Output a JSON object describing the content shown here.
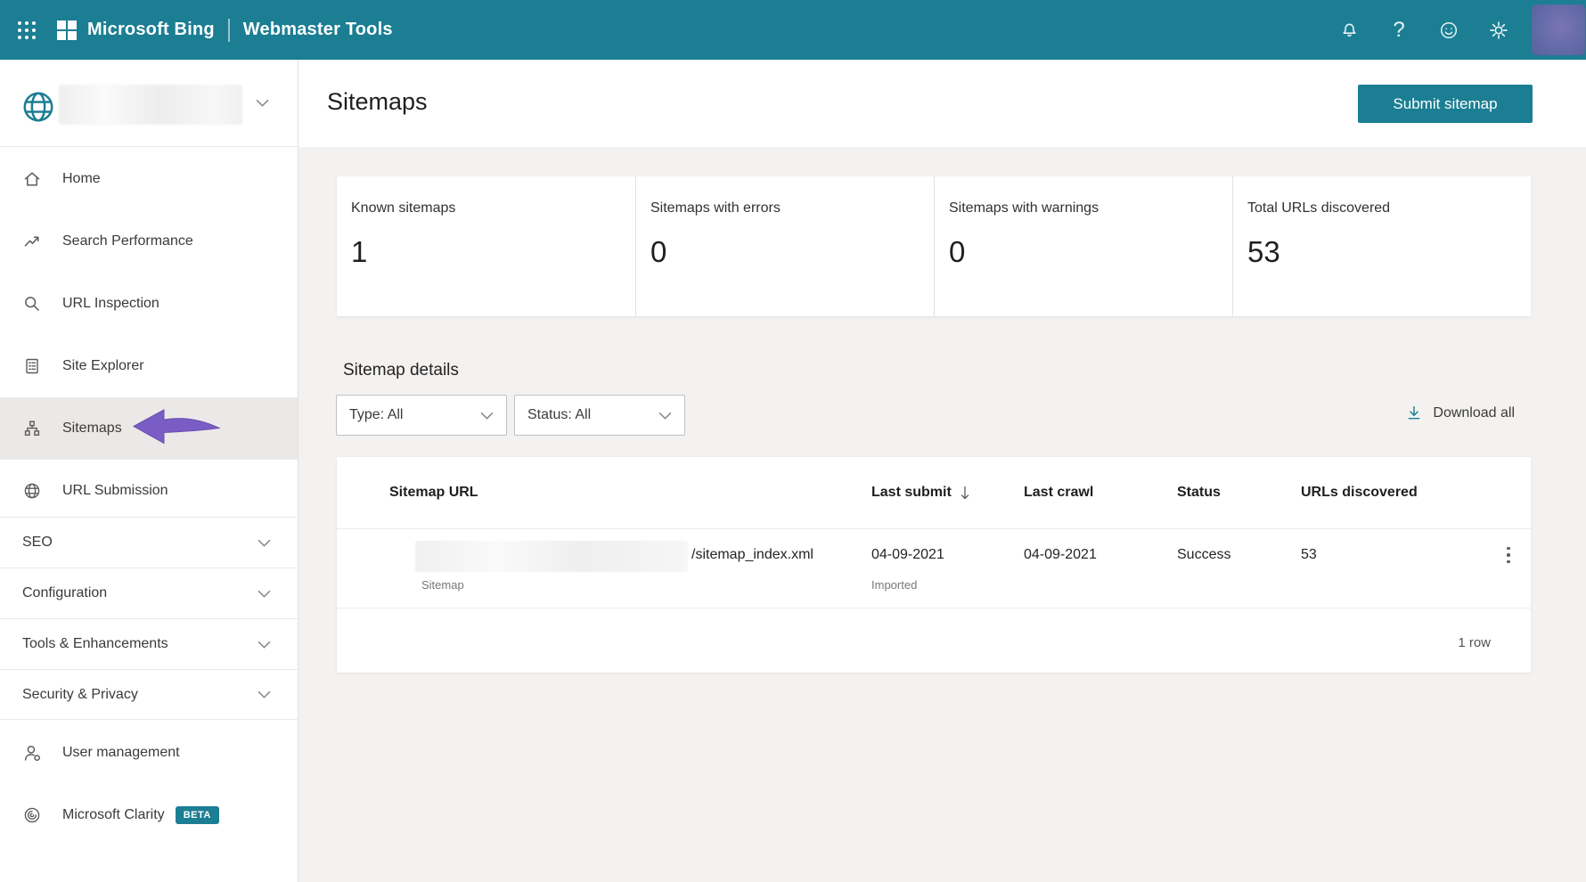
{
  "colors": {
    "accent_teal": "#1b7e93",
    "annotation_purple": "#7a5cc5",
    "page_bg": "#f3f2f1"
  },
  "header": {
    "brand": "Microsoft Bing",
    "product": "Webmaster Tools",
    "help_glyph": "?",
    "icons": [
      "waffle-menu",
      "bell",
      "help",
      "feedback-smiley",
      "settings-gear",
      "avatar"
    ]
  },
  "sidebar": {
    "items": [
      {
        "label": "Home"
      },
      {
        "label": "Search Performance"
      },
      {
        "label": "URL Inspection"
      },
      {
        "label": "Site Explorer"
      },
      {
        "label": "Sitemaps",
        "active": true
      },
      {
        "label": "URL Submission"
      }
    ],
    "sections": [
      {
        "label": "SEO"
      },
      {
        "label": "Configuration"
      },
      {
        "label": "Tools & Enhancements"
      },
      {
        "label": "Security & Privacy"
      }
    ],
    "footer_items": [
      {
        "label": "User management"
      },
      {
        "label": "Microsoft Clarity",
        "badge": "BETA"
      }
    ]
  },
  "main": {
    "title": "Sitemaps",
    "submit_button": "Submit sitemap",
    "stats": [
      {
        "label": "Known sitemaps",
        "value": "1"
      },
      {
        "label": "Sitemaps with errors",
        "value": "0"
      },
      {
        "label": "Sitemaps with warnings",
        "value": "0"
      },
      {
        "label": "Total URLs discovered",
        "value": "53"
      }
    ],
    "details": {
      "heading": "Sitemap details",
      "type_filter": "Type: All",
      "status_filter": "Status: All",
      "download": "Download all"
    },
    "table": {
      "columns": {
        "url": "Sitemap URL",
        "last_submit": "Last submit",
        "last_crawl": "Last crawl",
        "status": "Status",
        "urls": "URLs discovered"
      },
      "row": {
        "url_suffix": "/sitemap_index.xml",
        "type": "Sitemap",
        "last_submit": "04-09-2021",
        "submit_note": "Imported",
        "last_crawl": "04-09-2021",
        "status": "Success",
        "urls": "53"
      },
      "footer": "1 row"
    }
  }
}
